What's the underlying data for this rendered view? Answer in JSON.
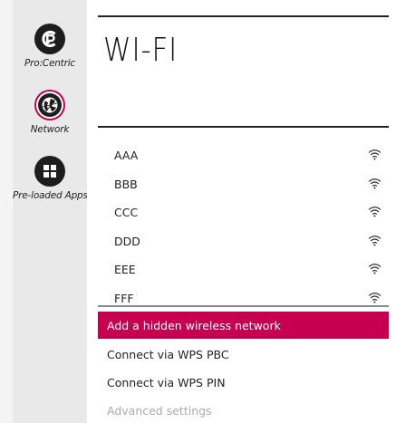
{
  "sidebar": {
    "items": [
      {
        "label": "Pro:Centric",
        "icon": "procentric-logo-icon"
      },
      {
        "label": "Network",
        "icon": "globe-network-icon",
        "selected": true
      },
      {
        "label": "Pre-loaded Apps",
        "icon": "apps-grid-icon"
      }
    ]
  },
  "page": {
    "title": "WI-FI"
  },
  "networks": [
    {
      "name": "AAA",
      "icon": "wifi-signal-icon"
    },
    {
      "name": "BBB",
      "icon": "wifi-signal-icon"
    },
    {
      "name": "CCC",
      "icon": "wifi-signal-icon"
    },
    {
      "name": "DDD",
      "icon": "wifi-signal-icon"
    },
    {
      "name": "EEE",
      "icon": "wifi-signal-icon"
    },
    {
      "name": "FFF",
      "icon": "wifi-signal-icon"
    }
  ],
  "actions": [
    {
      "label": "Add a hidden wireless network",
      "state": "selected"
    },
    {
      "label": "Connect via WPS PBC",
      "state": "normal"
    },
    {
      "label": "Connect via WPS PIN",
      "state": "normal"
    },
    {
      "label": "Advanced settings",
      "state": "disabled"
    }
  ],
  "colors": {
    "accent": "#c6004f",
    "sidebar_bg": "#e9e9e9",
    "icon_dark": "#1d1d1d"
  }
}
